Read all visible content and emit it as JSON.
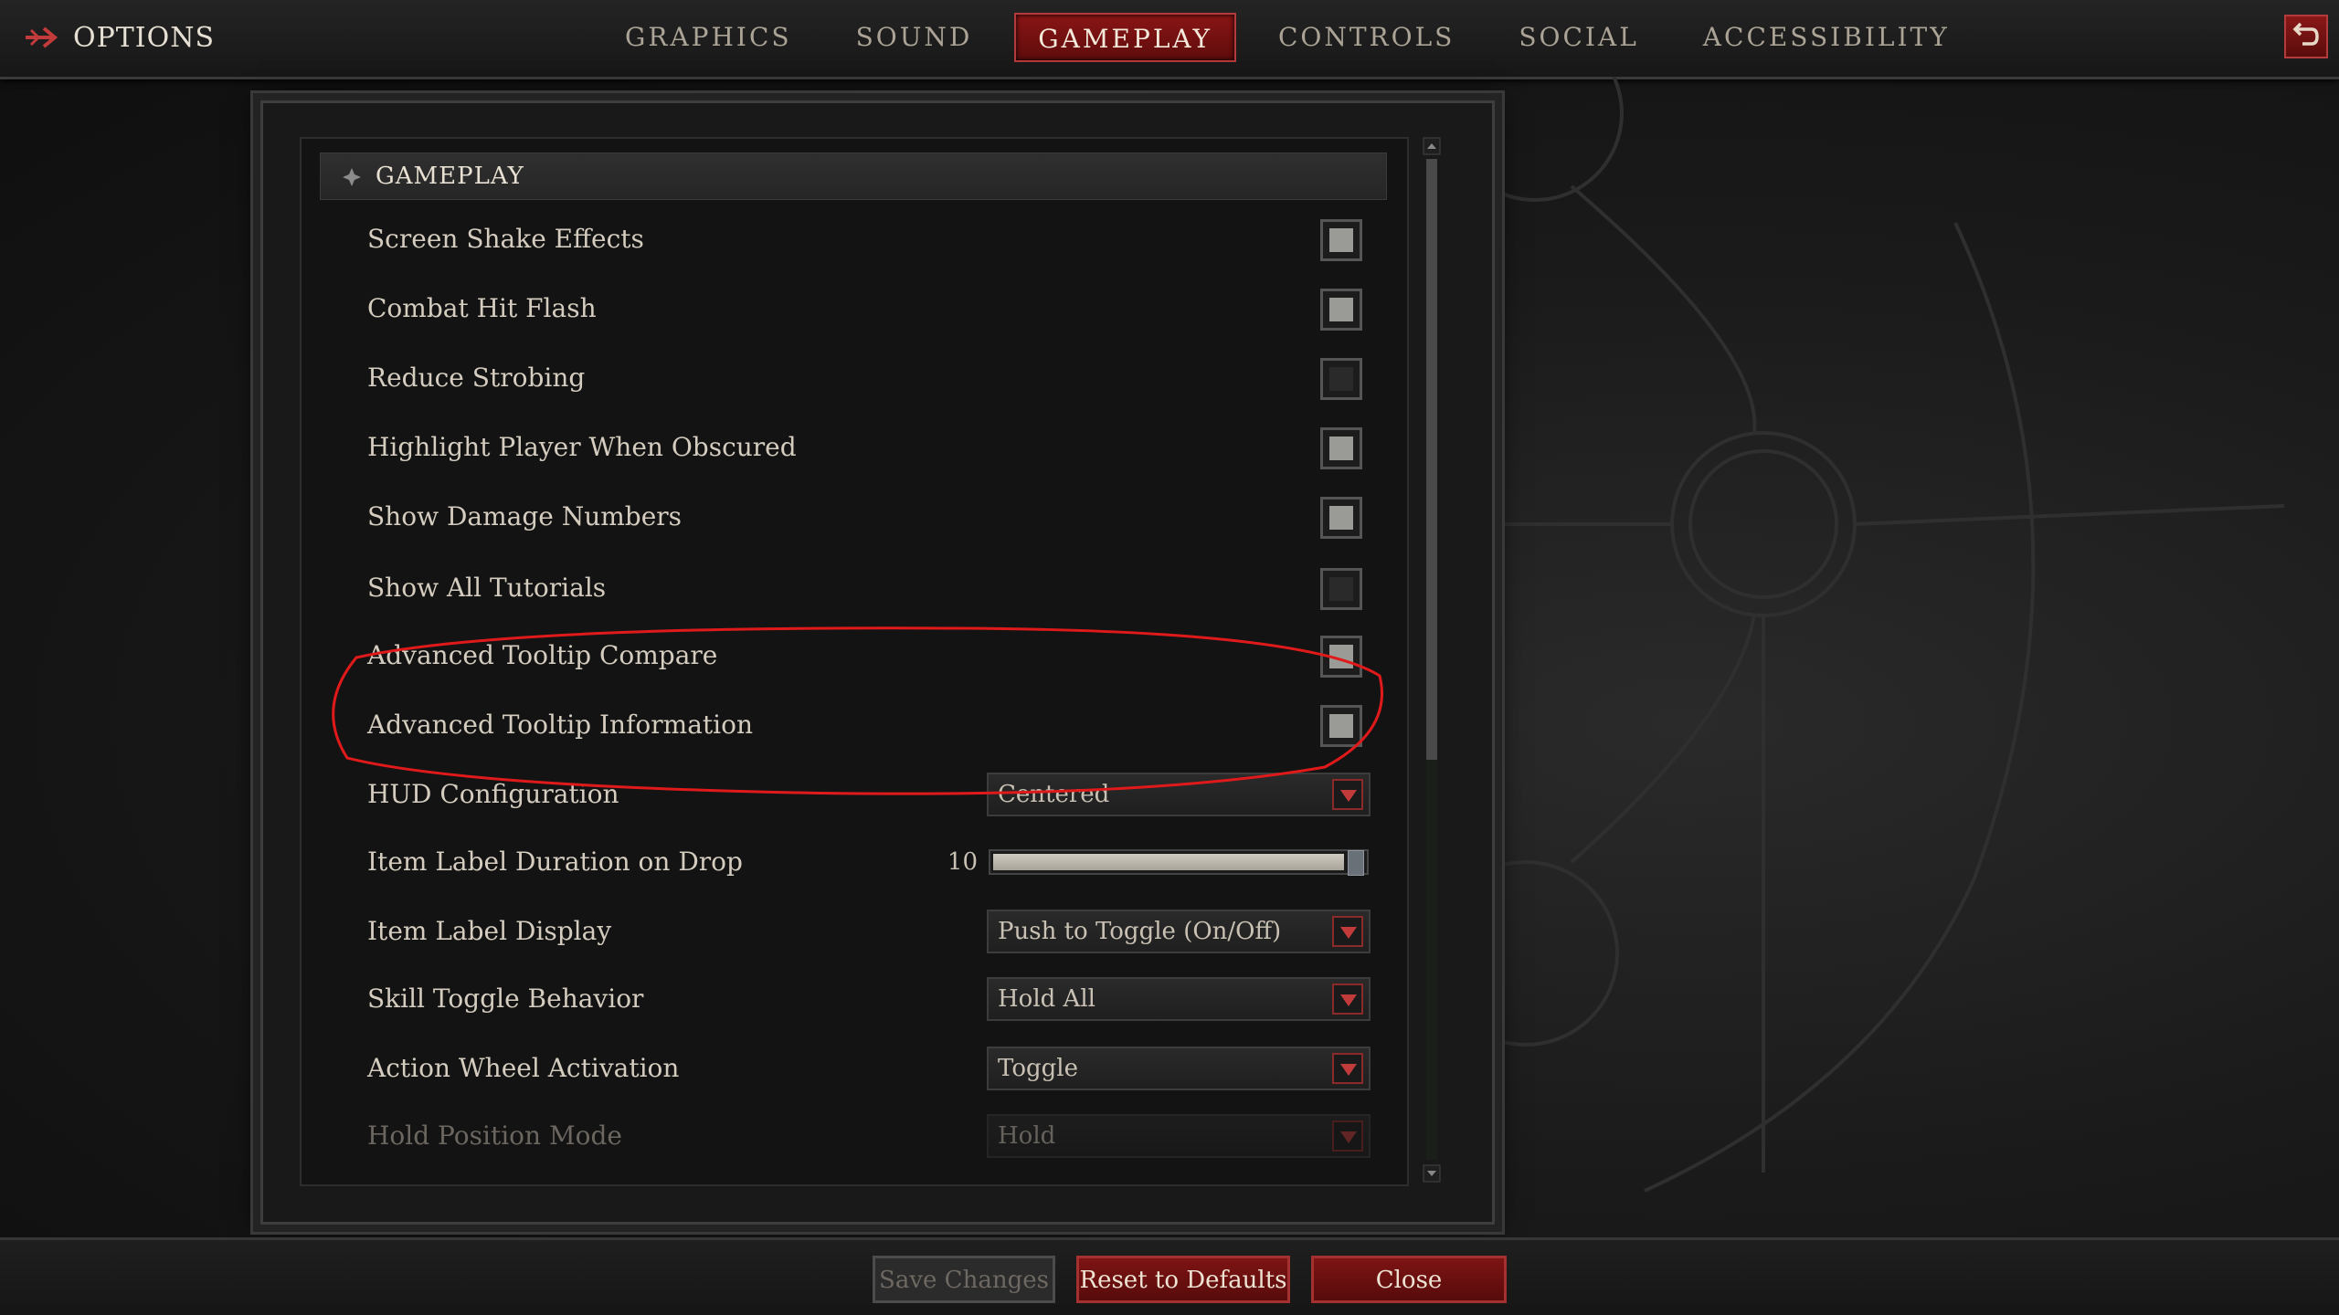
{
  "header": {
    "title": "OPTIONS",
    "tabs": [
      {
        "label": "GRAPHICS",
        "active": false
      },
      {
        "label": "SOUND",
        "active": false
      },
      {
        "label": "GAMEPLAY",
        "active": true
      },
      {
        "label": "CONTROLS",
        "active": false
      },
      {
        "label": "SOCIAL",
        "active": false
      },
      {
        "label": "ACCESSIBILITY",
        "active": false
      }
    ]
  },
  "section": {
    "title": "GAMEPLAY"
  },
  "settings": [
    {
      "label": "Screen Shake Effects",
      "type": "checkbox",
      "checked": true
    },
    {
      "label": "Combat Hit Flash",
      "type": "checkbox",
      "checked": true
    },
    {
      "label": "Reduce Strobing",
      "type": "checkbox",
      "checked": false
    },
    {
      "label": "Highlight Player When Obscured",
      "type": "checkbox",
      "checked": true
    },
    {
      "label": "Show Damage Numbers",
      "type": "checkbox",
      "checked": true
    },
    {
      "label": "Show All Tutorials",
      "type": "checkbox",
      "checked": false
    },
    {
      "label": "Advanced Tooltip Compare",
      "type": "checkbox",
      "checked": true
    },
    {
      "label": "Advanced Tooltip Information",
      "type": "checkbox",
      "checked": true
    },
    {
      "label": "HUD Configuration",
      "type": "dropdown",
      "value": "Centered"
    },
    {
      "label": "Item Label Duration on Drop",
      "type": "slider",
      "value": "10",
      "fraction": 0.99
    },
    {
      "label": "Item Label Display",
      "type": "dropdown",
      "value": "Push to Toggle (On/Off)"
    },
    {
      "label": "Skill Toggle Behavior",
      "type": "dropdown",
      "value": "Hold All"
    },
    {
      "label": "Action Wheel Activation",
      "type": "dropdown",
      "value": "Toggle"
    },
    {
      "label": "Hold Position Mode",
      "type": "dropdown",
      "value": "Hold",
      "dim": true
    }
  ],
  "scroll": {
    "position": 0.0,
    "visible_fraction": 0.6
  },
  "footer": {
    "save_label": "Save Changes",
    "reset_label": "Reset to Defaults",
    "close_label": "Close"
  },
  "colors": {
    "accent_red": "#8b1515",
    "annotation_red": "#e01a1a",
    "text": "#d4ccbf"
  },
  "icons": {
    "options": "options-arrow-icon",
    "back": "back-arrow-icon",
    "section": "diamond-icon"
  }
}
